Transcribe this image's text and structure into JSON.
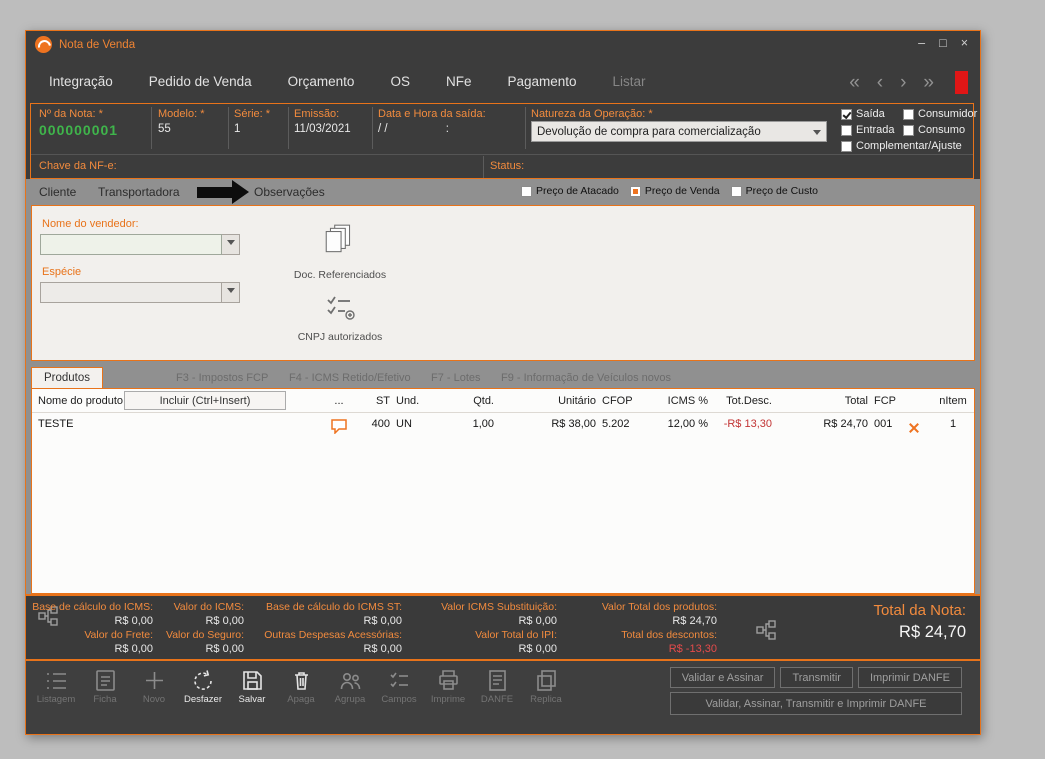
{
  "window": {
    "title": "Nota de Venda",
    "minimize": "–",
    "maximize": "□",
    "close": "×"
  },
  "nav": {
    "items": [
      {
        "label": "Integração"
      },
      {
        "label": "Pedido de Venda"
      },
      {
        "label": "Orçamento"
      },
      {
        "label": "OS"
      },
      {
        "label": "NFe"
      },
      {
        "label": "Pagamento"
      },
      {
        "label": "Listar"
      }
    ],
    "arrows": [
      "«",
      "‹",
      "›",
      "»"
    ]
  },
  "header": {
    "nota_label": "Nº da Nota: *",
    "nota_value": "000000001",
    "modelo_label": "Modelo: *",
    "modelo_value": "55",
    "serie_label": "Série: *",
    "serie_value": "1",
    "emissao_label": "Emissão:",
    "emissao_value": "11/03/2021",
    "saida_label": "Data e Hora da saída:",
    "saida_date": "/  /",
    "saida_time": ":",
    "natureza_label": "Natureza da Operação: *",
    "natureza_value": "Devolução de compra para comercialização",
    "chave_label": "Chave da NF-e:",
    "status_label": "Status:",
    "checks": [
      {
        "label": "Saída",
        "checked": true
      },
      {
        "label": "Consumidor",
        "checked": false
      },
      {
        "label": "Entrada",
        "checked": false
      },
      {
        "label": "Consumo",
        "checked": false
      },
      {
        "label": "Complementar/Ajuste",
        "checked": false
      }
    ]
  },
  "tabs": {
    "cliente": "Cliente",
    "transportadora": "Transportadora",
    "observacoes": "Observações",
    "price": [
      {
        "label": "Preço de Atacado",
        "selected": false
      },
      {
        "label": "Preço de Venda",
        "selected": true
      },
      {
        "label": "Preço de Custo",
        "selected": false
      }
    ]
  },
  "panel": {
    "vendedor_label": "Nome do vendedor:",
    "especie_label": "Espécie",
    "doc_ref_label": "Doc. Referenciados",
    "cnpj_label": "CNPJ autorizados"
  },
  "products": {
    "active_tab": "Produtos",
    "tabs": [
      "F3 - Impostos FCP",
      "F4 - ICMS Retido/Efetivo",
      "F7 - Lotes",
      "F9 - Informação de Veículos novos"
    ],
    "incluir_button": "Incluir (Ctrl+Insert)",
    "columns": {
      "nome": "Nome do produto",
      "dots": "...",
      "st": "ST",
      "und": "Und.",
      "qtd": "Qtd.",
      "unitario": "Unitário",
      "cfop": "CFOP",
      "icms": "ICMS %",
      "totdesc": "Tot.Desc.",
      "total": "Total",
      "fcp": "FCP",
      "nitem": "nItem"
    },
    "row": {
      "nome": "TESTE",
      "st": "400",
      "und": "UN",
      "qtd": "1,00",
      "unitario": "R$ 38,00",
      "cfop": "5.202",
      "icms": "12,00 %",
      "totdesc": "-R$ 13,30",
      "total": "R$ 24,70",
      "fcp": "001",
      "nitem": "1"
    }
  },
  "totals": {
    "cols": [
      {
        "l1": "Base de cálculo do ICMS:",
        "v1": "R$ 0,00",
        "l2": "Valor do Frete:",
        "v2": "R$ 0,00"
      },
      {
        "l1": "Valor do ICMS:",
        "v1": "R$ 0,00",
        "l2": "Valor do Seguro:",
        "v2": "R$ 0,00"
      },
      {
        "l1": "Base de cálculo do ICMS ST:",
        "v1": "R$ 0,00",
        "l2": "Outras Despesas Acessórias:",
        "v2": "R$ 0,00"
      },
      {
        "l1": "Valor ICMS Substituição:",
        "v1": "R$ 0,00",
        "l2": "Valor Total do IPI:",
        "v2": "R$ 0,00"
      },
      {
        "l1": "Valor Total dos produtos:",
        "v1": "R$ 24,70",
        "l2": "Total dos descontos:",
        "v2": "R$ -13,30"
      }
    ],
    "total_label": "Total da Nota:",
    "total_value": "R$ 24,70"
  },
  "toolbar": {
    "items": [
      {
        "label": "Listagem"
      },
      {
        "label": "Ficha"
      },
      {
        "label": "Novo"
      },
      {
        "label": "Desfazer"
      },
      {
        "label": "Salvar"
      },
      {
        "label": "Apaga"
      },
      {
        "label": "Agrupa"
      },
      {
        "label": "Campos"
      },
      {
        "label": "Imprime"
      },
      {
        "label": "DANFE"
      },
      {
        "label": "Replica"
      }
    ],
    "buttons": [
      "Validar e Assinar",
      "Transmitir",
      "Imprimir DANFE",
      "Validar, Assinar, Transmitir e Imprimir DANFE"
    ]
  }
}
